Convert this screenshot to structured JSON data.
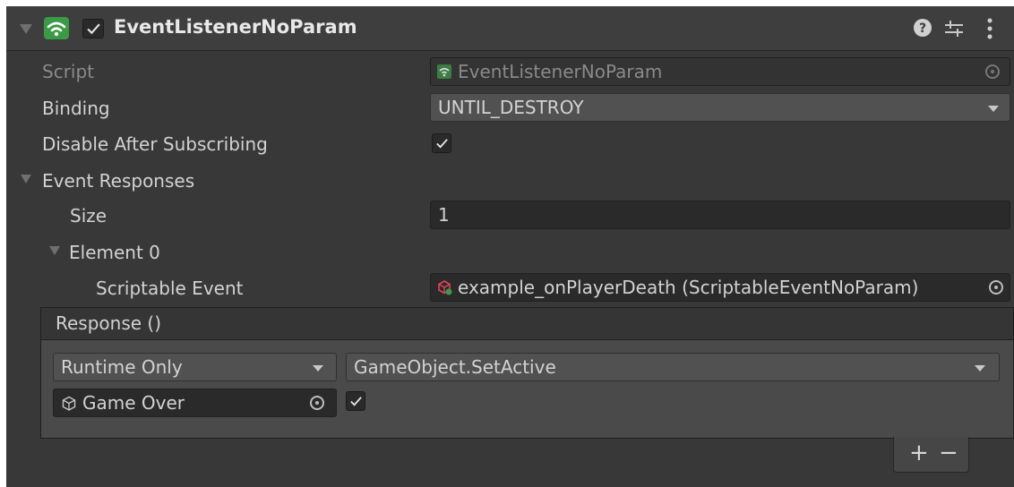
{
  "component": {
    "title": "EventListenerNoParam",
    "enabled": true
  },
  "fields": {
    "script": {
      "label": "Script",
      "value": "EventListenerNoParam"
    },
    "binding": {
      "label": "Binding",
      "value": "UNTIL_DESTROY"
    },
    "disable_after": {
      "label": "Disable After Subscribing",
      "checked": true
    },
    "event_responses": {
      "label": "Event Responses",
      "size_label": "Size",
      "size_value": "1",
      "element_label": "Element 0",
      "scriptable_event_label": "Scriptable Event",
      "scriptable_event_value": "example_onPlayerDeath (ScriptableEventNoParam)"
    }
  },
  "unity_event": {
    "header": "Response ()",
    "call_state": "Runtime Only",
    "function": "GameObject.SetActive",
    "target_object": "Game Over",
    "arg_checked": true,
    "add_label": "+",
    "remove_label": "−"
  },
  "colors": {
    "panel_bg": "#383838",
    "header_bg": "#3e3e3e",
    "field_bg": "#2a2a2a",
    "accent_green": "#3a9a45",
    "event_icon": "#e0455a"
  },
  "icons": [
    "wifi-script-icon",
    "checkmark-icon",
    "help-icon",
    "preset-icon",
    "kebab-menu-icon",
    "object-picker-icon",
    "cube-icon",
    "scriptable-event-icon"
  ]
}
